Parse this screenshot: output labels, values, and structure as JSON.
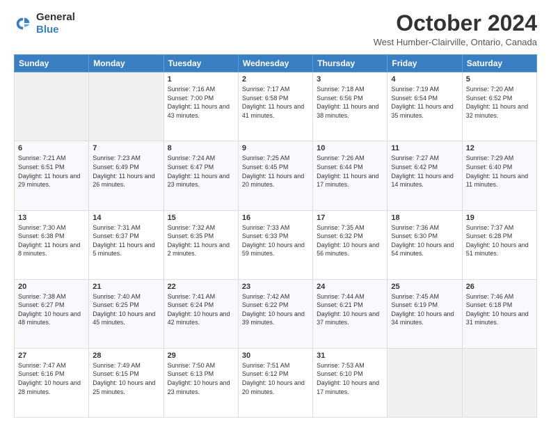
{
  "header": {
    "logo_line1": "General",
    "logo_line2": "Blue",
    "month": "October 2024",
    "location": "West Humber-Clairville, Ontario, Canada"
  },
  "days_of_week": [
    "Sunday",
    "Monday",
    "Tuesday",
    "Wednesday",
    "Thursday",
    "Friday",
    "Saturday"
  ],
  "weeks": [
    [
      {
        "day": "",
        "info": ""
      },
      {
        "day": "",
        "info": ""
      },
      {
        "day": "1",
        "info": "Sunrise: 7:16 AM\nSunset: 7:00 PM\nDaylight: 11 hours and 43 minutes."
      },
      {
        "day": "2",
        "info": "Sunrise: 7:17 AM\nSunset: 6:58 PM\nDaylight: 11 hours and 41 minutes."
      },
      {
        "day": "3",
        "info": "Sunrise: 7:18 AM\nSunset: 6:56 PM\nDaylight: 11 hours and 38 minutes."
      },
      {
        "day": "4",
        "info": "Sunrise: 7:19 AM\nSunset: 6:54 PM\nDaylight: 11 hours and 35 minutes."
      },
      {
        "day": "5",
        "info": "Sunrise: 7:20 AM\nSunset: 6:52 PM\nDaylight: 11 hours and 32 minutes."
      }
    ],
    [
      {
        "day": "6",
        "info": "Sunrise: 7:21 AM\nSunset: 6:51 PM\nDaylight: 11 hours and 29 minutes."
      },
      {
        "day": "7",
        "info": "Sunrise: 7:23 AM\nSunset: 6:49 PM\nDaylight: 11 hours and 26 minutes."
      },
      {
        "day": "8",
        "info": "Sunrise: 7:24 AM\nSunset: 6:47 PM\nDaylight: 11 hours and 23 minutes."
      },
      {
        "day": "9",
        "info": "Sunrise: 7:25 AM\nSunset: 6:45 PM\nDaylight: 11 hours and 20 minutes."
      },
      {
        "day": "10",
        "info": "Sunrise: 7:26 AM\nSunset: 6:44 PM\nDaylight: 11 hours and 17 minutes."
      },
      {
        "day": "11",
        "info": "Sunrise: 7:27 AM\nSunset: 6:42 PM\nDaylight: 11 hours and 14 minutes."
      },
      {
        "day": "12",
        "info": "Sunrise: 7:29 AM\nSunset: 6:40 PM\nDaylight: 11 hours and 11 minutes."
      }
    ],
    [
      {
        "day": "13",
        "info": "Sunrise: 7:30 AM\nSunset: 6:38 PM\nDaylight: 11 hours and 8 minutes."
      },
      {
        "day": "14",
        "info": "Sunrise: 7:31 AM\nSunset: 6:37 PM\nDaylight: 11 hours and 5 minutes."
      },
      {
        "day": "15",
        "info": "Sunrise: 7:32 AM\nSunset: 6:35 PM\nDaylight: 11 hours and 2 minutes."
      },
      {
        "day": "16",
        "info": "Sunrise: 7:33 AM\nSunset: 6:33 PM\nDaylight: 10 hours and 59 minutes."
      },
      {
        "day": "17",
        "info": "Sunrise: 7:35 AM\nSunset: 6:32 PM\nDaylight: 10 hours and 56 minutes."
      },
      {
        "day": "18",
        "info": "Sunrise: 7:36 AM\nSunset: 6:30 PM\nDaylight: 10 hours and 54 minutes."
      },
      {
        "day": "19",
        "info": "Sunrise: 7:37 AM\nSunset: 6:28 PM\nDaylight: 10 hours and 51 minutes."
      }
    ],
    [
      {
        "day": "20",
        "info": "Sunrise: 7:38 AM\nSunset: 6:27 PM\nDaylight: 10 hours and 48 minutes."
      },
      {
        "day": "21",
        "info": "Sunrise: 7:40 AM\nSunset: 6:25 PM\nDaylight: 10 hours and 45 minutes."
      },
      {
        "day": "22",
        "info": "Sunrise: 7:41 AM\nSunset: 6:24 PM\nDaylight: 10 hours and 42 minutes."
      },
      {
        "day": "23",
        "info": "Sunrise: 7:42 AM\nSunset: 6:22 PM\nDaylight: 10 hours and 39 minutes."
      },
      {
        "day": "24",
        "info": "Sunrise: 7:44 AM\nSunset: 6:21 PM\nDaylight: 10 hours and 37 minutes."
      },
      {
        "day": "25",
        "info": "Sunrise: 7:45 AM\nSunset: 6:19 PM\nDaylight: 10 hours and 34 minutes."
      },
      {
        "day": "26",
        "info": "Sunrise: 7:46 AM\nSunset: 6:18 PM\nDaylight: 10 hours and 31 minutes."
      }
    ],
    [
      {
        "day": "27",
        "info": "Sunrise: 7:47 AM\nSunset: 6:16 PM\nDaylight: 10 hours and 28 minutes."
      },
      {
        "day": "28",
        "info": "Sunrise: 7:49 AM\nSunset: 6:15 PM\nDaylight: 10 hours and 25 minutes."
      },
      {
        "day": "29",
        "info": "Sunrise: 7:50 AM\nSunset: 6:13 PM\nDaylight: 10 hours and 23 minutes."
      },
      {
        "day": "30",
        "info": "Sunrise: 7:51 AM\nSunset: 6:12 PM\nDaylight: 10 hours and 20 minutes."
      },
      {
        "day": "31",
        "info": "Sunrise: 7:53 AM\nSunset: 6:10 PM\nDaylight: 10 hours and 17 minutes."
      },
      {
        "day": "",
        "info": ""
      },
      {
        "day": "",
        "info": ""
      }
    ]
  ]
}
